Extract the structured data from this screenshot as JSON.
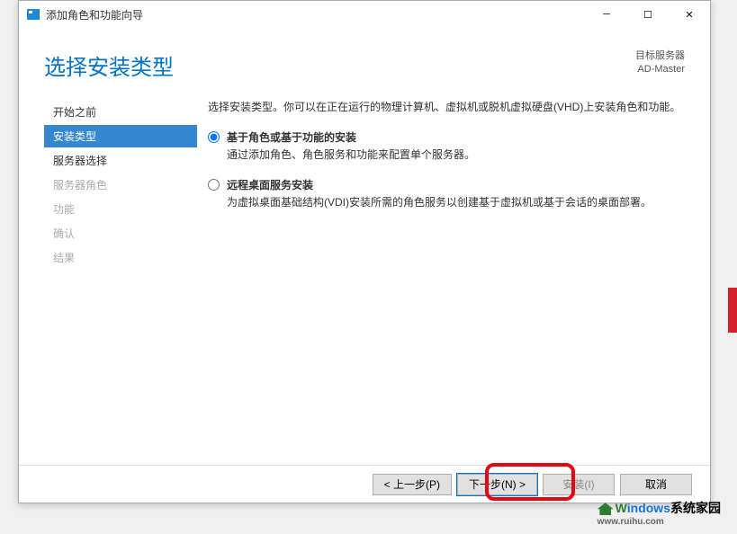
{
  "titlebar": {
    "title": "添加角色和功能向导"
  },
  "header": {
    "page_title": "选择安装类型",
    "target_label": "目标服务器",
    "target_name": "AD-Master"
  },
  "sidebar": {
    "items": [
      {
        "label": "开始之前",
        "state": "normal"
      },
      {
        "label": "安装类型",
        "state": "active"
      },
      {
        "label": "服务器选择",
        "state": "normal"
      },
      {
        "label": "服务器角色",
        "state": "disabled"
      },
      {
        "label": "功能",
        "state": "disabled"
      },
      {
        "label": "确认",
        "state": "disabled"
      },
      {
        "label": "结果",
        "state": "disabled"
      }
    ]
  },
  "main": {
    "intro": "选择安装类型。你可以在正在运行的物理计算机、虚拟机或脱机虚拟硬盘(VHD)上安装角色和功能。",
    "options": [
      {
        "title": "基于角色或基于功能的安装",
        "desc": "通过添加角色、角色服务和功能来配置单个服务器。",
        "selected": true
      },
      {
        "title": "远程桌面服务安装",
        "desc": "为虚拟桌面基础结构(VDI)安装所需的角色服务以创建基于虚拟机或基于会话的桌面部署。",
        "selected": false
      }
    ]
  },
  "footer": {
    "prev": "< 上一步(P)",
    "next": "下一步(N) >",
    "install": "安装(I)",
    "cancel": "取消"
  },
  "watermark": {
    "brand1": "W",
    "brand2": "indows",
    "brand3": "系统家园",
    "url": "www.ruihu.com"
  }
}
